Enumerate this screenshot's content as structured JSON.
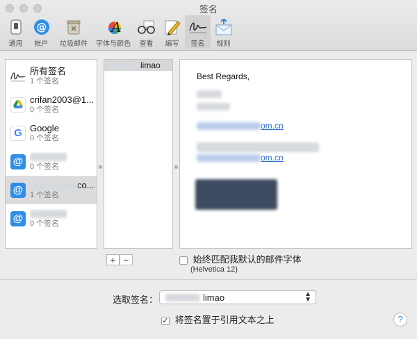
{
  "window": {
    "title": "签名"
  },
  "toolbar": {
    "items": [
      {
        "label": "通用",
        "icon": "general-switch-icon"
      },
      {
        "label": "帐户",
        "icon": "at-sign-icon"
      },
      {
        "label": "垃圾邮件",
        "icon": "trash-bin-icon"
      },
      {
        "label": "字体与颜色",
        "icon": "font-color-icon"
      },
      {
        "label": "查看",
        "icon": "glasses-icon"
      },
      {
        "label": "编写",
        "icon": "compose-pencil-icon"
      },
      {
        "label": "签名",
        "icon": "signature-icon"
      },
      {
        "label": "规则",
        "icon": "rules-envelope-icon"
      }
    ],
    "active": "签名"
  },
  "accounts": [
    {
      "name": "所有签名",
      "count": "1 个签名",
      "icon": "signature-icon"
    },
    {
      "name": "crifan2003@1...",
      "count": "0 个签名",
      "icon": "google-drive-icon"
    },
    {
      "name": "Google",
      "count": "0 个签名",
      "icon": "google-icon"
    },
    {
      "name": "",
      "count": "0 个签名",
      "icon": "at-sign-icon"
    },
    {
      "name": "co...",
      "count": "1 个签名",
      "icon": "at-sign-icon",
      "selected": true
    },
    {
      "name": "",
      "count": "0 个签名",
      "icon": "at-sign-icon"
    }
  ],
  "signatures": [
    {
      "name": "limao"
    }
  ],
  "preview": {
    "greeting": "Best Regards,",
    "link1_suffix": "om.cn",
    "link2_suffix": "om.cn"
  },
  "buttons": {
    "add": "+",
    "remove": "−"
  },
  "options": {
    "match_font_label": "始终匹配我默认的邮件字体",
    "match_font_checked": false,
    "font_hint": "(Helvetica 12)",
    "place_above_label": "将签名置于引用文本之上",
    "place_above_checked": true,
    "check_mark": "✓"
  },
  "choose": {
    "label": "选取签名：",
    "value": "limao"
  },
  "help": "?"
}
